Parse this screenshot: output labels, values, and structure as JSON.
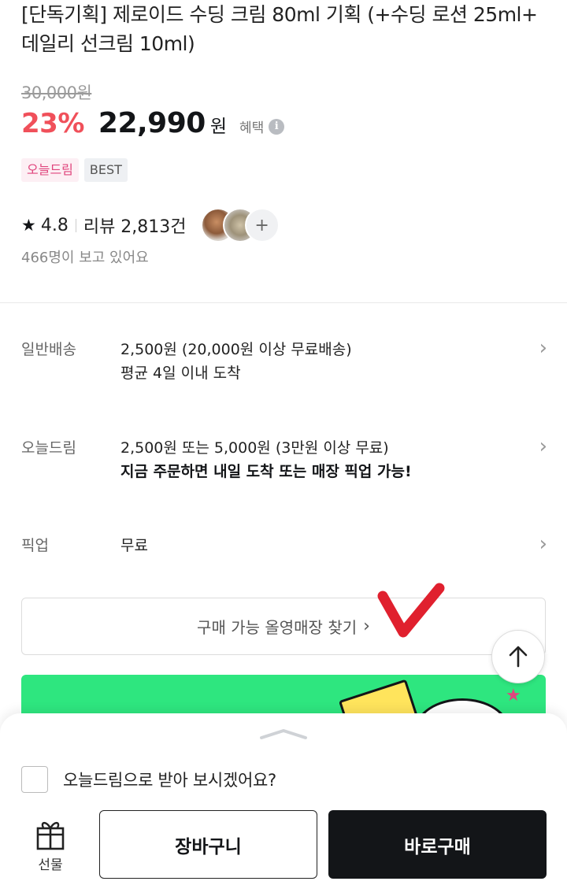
{
  "product": {
    "title": "[단독기획] 제로이드 수딩 크림 80ml 기획 (+수딩 로션 25ml+ 데일리 선크림 10ml)",
    "original_price": "30,000원",
    "discount": "23%",
    "sale_price": "22,990",
    "currency": "원",
    "benefit_label": "혜택",
    "info_glyph": "i",
    "badges": [
      "오늘드림",
      "BEST"
    ]
  },
  "rating": {
    "star_glyph": "★",
    "score": "4.8",
    "reviews": "리뷰 2,813건",
    "more_glyph": "+",
    "viewers": "466명이 보고 있어요"
  },
  "shipping": [
    {
      "label": "일반배송",
      "line1": "2,500원 (20,000원 이상 무료배송)",
      "line2": "평균 4일 이내 도착"
    },
    {
      "label": "오늘드림",
      "line1": "2,500원 또는 5,000원 (3만원 이상 무료)",
      "line2": "지금 주문하면 내일 도착 또는 매장 픽업 가능!"
    },
    {
      "label": "픽업",
      "line1": "무료",
      "line2": ""
    }
  ],
  "chevron_glyph": "›",
  "find_store": {
    "label": "구매 가능 올영매장 찾기",
    "arrow": "›"
  },
  "bottom_sheet": {
    "today_delivery_question": "오늘드림으로 받아 보시겠어요?",
    "gift_label": "선물",
    "cart_label": "장바구니",
    "buy_label": "바로구매"
  },
  "colors": {
    "discount": "#f0505a",
    "banner": "#2ee67f",
    "buy_button": "#131518",
    "checkmark": "#e0202e"
  },
  "icons": [
    "info-icon",
    "star-icon",
    "chevron-right-icon",
    "scroll-to-top-icon",
    "gift-icon",
    "sheet-handle-icon",
    "red-checkmark-annotation"
  ]
}
